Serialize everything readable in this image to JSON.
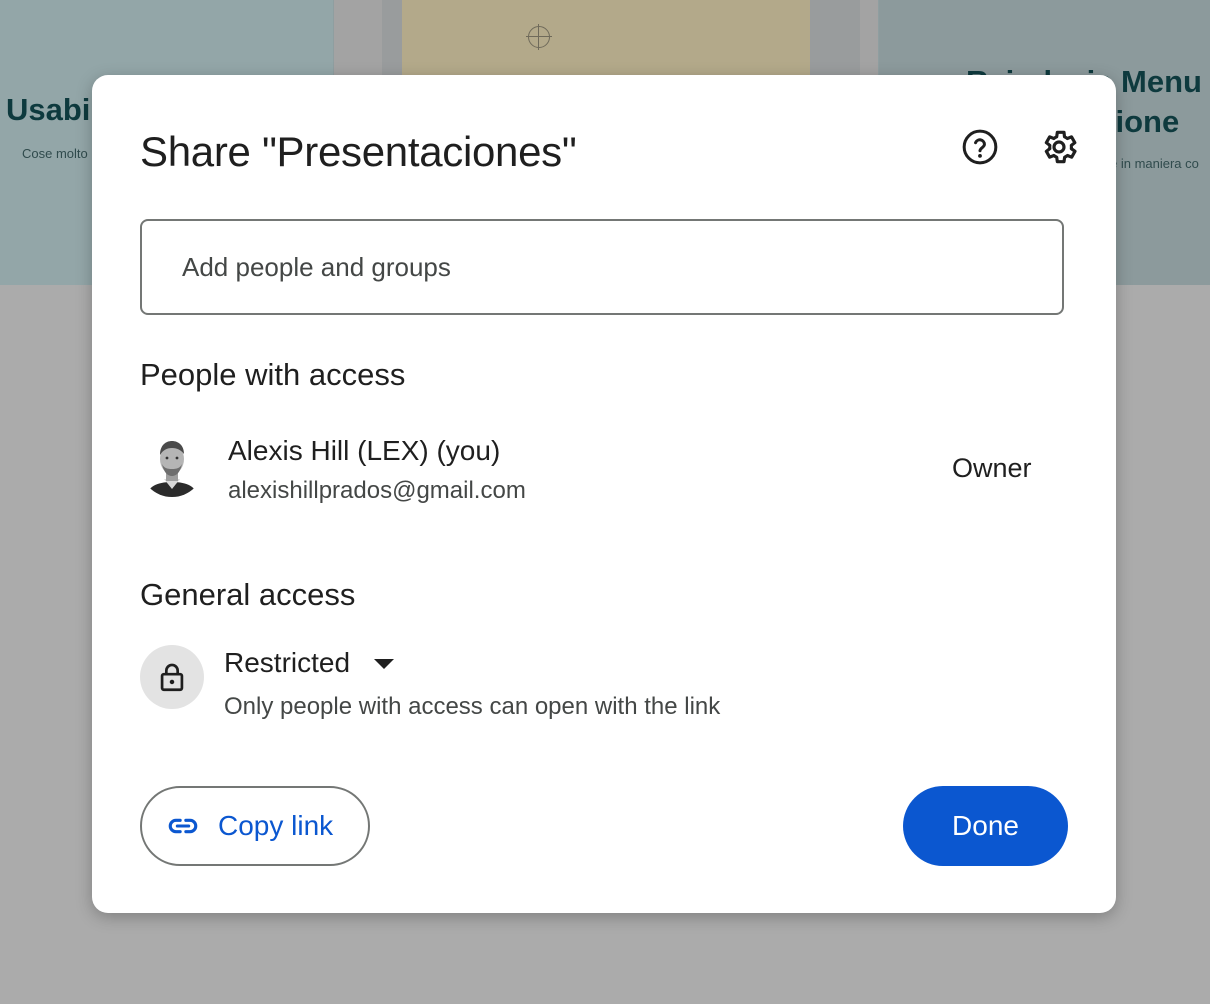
{
  "background": {
    "left_title": "Usabi",
    "left_subtitle": "Cose molto",
    "right_title_line1": "Reindexia Menu",
    "right_title_line2": "zione",
    "right_subtitle": "e in maniera co"
  },
  "dialog": {
    "title": "Share \"Presentaciones\"",
    "help_icon": "help-circle-icon",
    "settings_icon": "gear-icon",
    "add_people_placeholder": "Add people and groups",
    "people_with_access_heading": "People with access",
    "people": [
      {
        "name": "Alexis Hill (LEX) (you)",
        "email": "alexishillprados@gmail.com",
        "role": "Owner"
      }
    ],
    "general_access_heading": "General access",
    "general_access": {
      "icon": "lock-icon",
      "selected": "Restricted",
      "description": "Only people with access can open with the link"
    },
    "copy_link_label": "Copy link",
    "done_label": "Done"
  },
  "colors": {
    "primary": "#0b57d0",
    "text": "#1f1f1f",
    "secondary_text": "#444746",
    "outline": "#747775"
  }
}
